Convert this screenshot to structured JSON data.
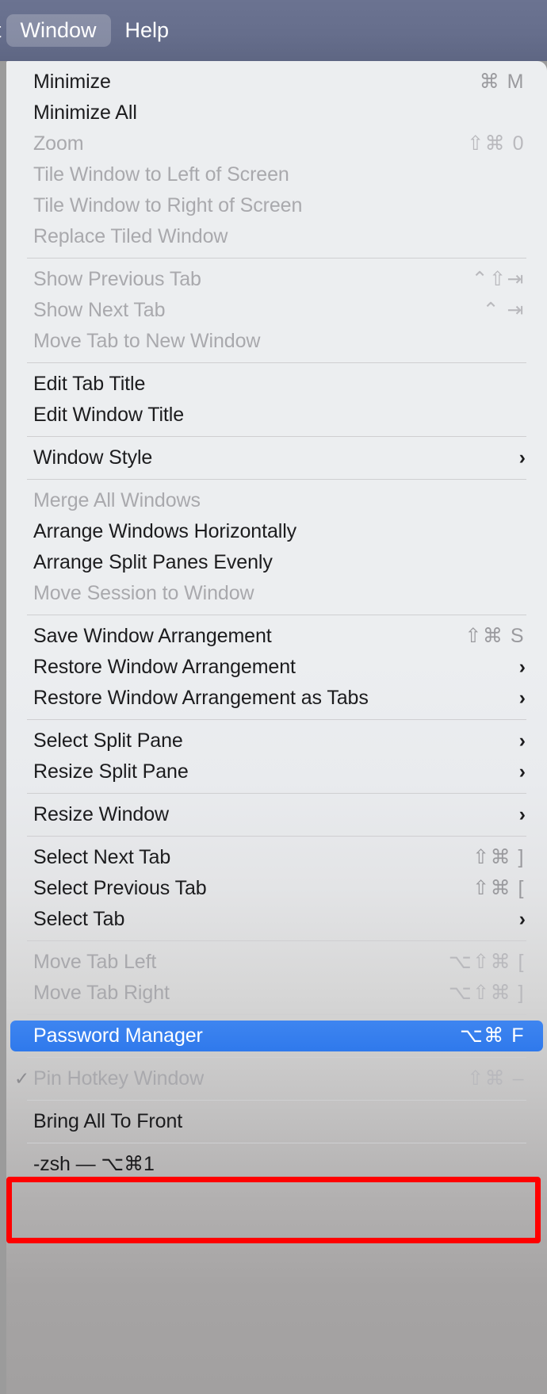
{
  "menubar": {
    "items": [
      {
        "label": "t",
        "state": "truncated"
      },
      {
        "label": "Window",
        "state": "active"
      },
      {
        "label": "Help",
        "state": "normal"
      }
    ]
  },
  "menu": {
    "title": "Window",
    "groups": [
      {
        "items": [
          {
            "label": "Minimize",
            "shortcut": "⌘ M",
            "enabled": true,
            "submenu": false,
            "checked": false
          },
          {
            "label": "Minimize All",
            "shortcut": "",
            "enabled": true,
            "submenu": false,
            "checked": false
          },
          {
            "label": "Zoom",
            "shortcut": "⇧⌘ 0",
            "enabled": false,
            "submenu": false,
            "checked": false
          },
          {
            "label": "Tile Window to Left of Screen",
            "shortcut": "",
            "enabled": false,
            "submenu": false,
            "checked": false
          },
          {
            "label": "Tile Window to Right of Screen",
            "shortcut": "",
            "enabled": false,
            "submenu": false,
            "checked": false
          },
          {
            "label": "Replace Tiled Window",
            "shortcut": "",
            "enabled": false,
            "submenu": false,
            "checked": false
          }
        ]
      },
      {
        "items": [
          {
            "label": "Show Previous Tab",
            "shortcut": "⌃⇧⇥",
            "enabled": false,
            "submenu": false,
            "checked": false
          },
          {
            "label": "Show Next Tab",
            "shortcut": "⌃ ⇥",
            "enabled": false,
            "submenu": false,
            "checked": false
          },
          {
            "label": "Move Tab to New Window",
            "shortcut": "",
            "enabled": false,
            "submenu": false,
            "checked": false
          }
        ]
      },
      {
        "items": [
          {
            "label": "Edit Tab Title",
            "shortcut": "",
            "enabled": true,
            "submenu": false,
            "checked": false
          },
          {
            "label": "Edit Window Title",
            "shortcut": "",
            "enabled": true,
            "submenu": false,
            "checked": false
          }
        ]
      },
      {
        "items": [
          {
            "label": "Window Style",
            "shortcut": "",
            "enabled": true,
            "submenu": true,
            "checked": false
          }
        ]
      },
      {
        "items": [
          {
            "label": "Merge All Windows",
            "shortcut": "",
            "enabled": false,
            "submenu": false,
            "checked": false
          },
          {
            "label": "Arrange Windows Horizontally",
            "shortcut": "",
            "enabled": true,
            "submenu": false,
            "checked": false
          },
          {
            "label": "Arrange Split Panes Evenly",
            "shortcut": "",
            "enabled": true,
            "submenu": false,
            "checked": false
          },
          {
            "label": "Move Session to Window",
            "shortcut": "",
            "enabled": false,
            "submenu": false,
            "checked": false
          }
        ]
      },
      {
        "items": [
          {
            "label": "Save Window Arrangement",
            "shortcut": "⇧⌘ S",
            "enabled": true,
            "submenu": false,
            "checked": false
          },
          {
            "label": "Restore Window Arrangement",
            "shortcut": "",
            "enabled": true,
            "submenu": true,
            "checked": false
          },
          {
            "label": "Restore Window Arrangement as Tabs",
            "shortcut": "",
            "enabled": true,
            "submenu": true,
            "checked": false
          }
        ]
      },
      {
        "items": [
          {
            "label": "Select Split Pane",
            "shortcut": "",
            "enabled": true,
            "submenu": true,
            "checked": false
          },
          {
            "label": "Resize Split Pane",
            "shortcut": "",
            "enabled": true,
            "submenu": true,
            "checked": false
          }
        ]
      },
      {
        "items": [
          {
            "label": "Resize Window",
            "shortcut": "",
            "enabled": true,
            "submenu": true,
            "checked": false
          }
        ]
      },
      {
        "items": [
          {
            "label": "Select Next Tab",
            "shortcut": "⇧⌘ ]",
            "enabled": true,
            "submenu": false,
            "checked": false
          },
          {
            "label": "Select Previous Tab",
            "shortcut": "⇧⌘ [",
            "enabled": true,
            "submenu": false,
            "checked": false
          },
          {
            "label": "Select Tab",
            "shortcut": "",
            "enabled": true,
            "submenu": true,
            "checked": false
          }
        ]
      },
      {
        "items": [
          {
            "label": "Move Tab Left",
            "shortcut": "⌥⇧⌘ [",
            "enabled": false,
            "submenu": false,
            "checked": false
          },
          {
            "label": "Move Tab Right",
            "shortcut": "⌥⇧⌘ ]",
            "enabled": false,
            "submenu": false,
            "checked": false
          }
        ]
      },
      {
        "items": [
          {
            "label": "Password Manager",
            "shortcut": "⌥⌘ F",
            "enabled": true,
            "submenu": false,
            "checked": false,
            "highlighted": true
          }
        ]
      },
      {
        "items": [
          {
            "label": "Pin Hotkey Window",
            "shortcut": "⇧⌘ –",
            "enabled": false,
            "submenu": false,
            "checked": true
          }
        ]
      },
      {
        "items": [
          {
            "label": "Bring All To Front",
            "shortcut": "",
            "enabled": true,
            "submenu": false,
            "checked": false
          }
        ]
      },
      {
        "items": [
          {
            "label": "-zsh — ⌥⌘1",
            "shortcut": "",
            "enabled": true,
            "submenu": false,
            "checked": false
          }
        ]
      }
    ]
  },
  "annotation": {
    "type": "highlight-box",
    "color": "#ff0000",
    "target": "Password Manager"
  },
  "icons": {
    "submenu_chevron": "›",
    "checkmark": "✓"
  }
}
